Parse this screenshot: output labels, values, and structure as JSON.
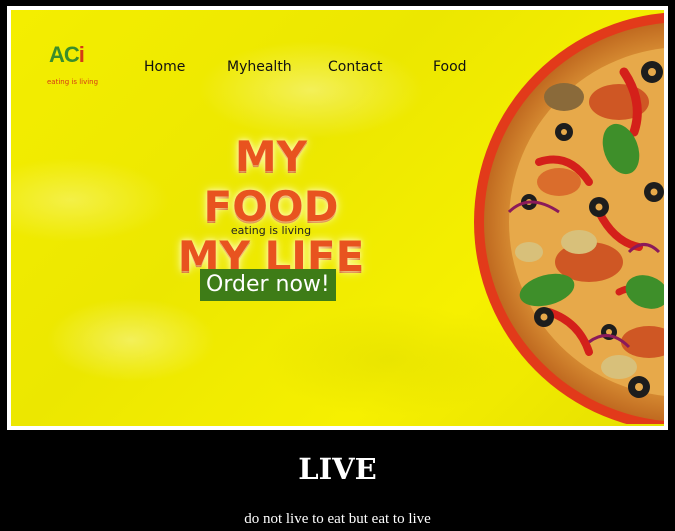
{
  "brand": {
    "logo_mark_a": "AC",
    "logo_mark_b": "i",
    "logo_tagline": "eating is living"
  },
  "nav": {
    "items": [
      {
        "label": "Home"
      },
      {
        "label": "Myhealth"
      },
      {
        "label": "Contact"
      },
      {
        "label": "Food"
      }
    ]
  },
  "hero": {
    "headline_line1": "MY FOOD",
    "headline_line2": "MY LIFE",
    "tagline": "eating is living",
    "cta_label": "Order now!"
  },
  "footer": {
    "title": "LIVE",
    "subtitle": "do not live to eat but eat to live"
  },
  "colors": {
    "hero_bg": "#f2ec00",
    "accent_orange": "#e8531f",
    "cta_green": "#3e7c17",
    "pizza_rim": "#e23a1a"
  },
  "icons": {
    "logo": "brand-logo-icon",
    "pizza": "pizza-image"
  }
}
